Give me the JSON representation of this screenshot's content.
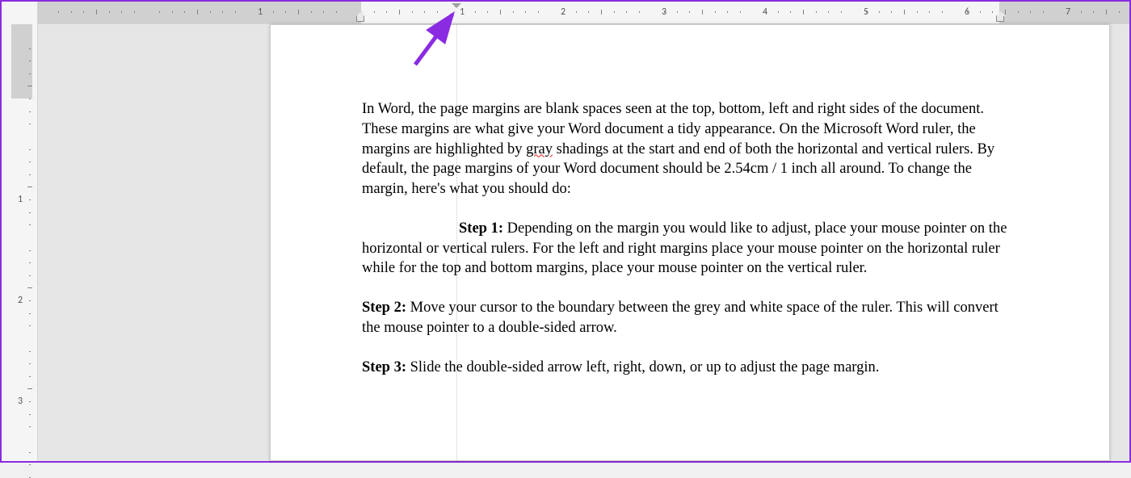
{
  "ruler": {
    "h_numbers": [
      1,
      1,
      2,
      3,
      4,
      5,
      6,
      7
    ],
    "v_numbers": [
      1,
      2,
      3
    ]
  },
  "document": {
    "intro": "In Word, the page margins are blank spaces seen at the top, bottom, left and right sides of the document. These margins are what give your Word document a tidy appearance. On the Microsoft Word ruler, the margins are highlighted by ",
    "spellerr": "gray",
    "intro2": " shadings at the start and end of both the horizontal and vertical rulers. By default, the page margins of your Word document should be 2.54cm / 1 inch all around. To change the margin, here's what you should do:",
    "step1_label": "Step 1:",
    "step1_body": " Depending on the margin you would like to adjust, place your mouse pointer on the horizontal or vertical rulers. For the left and right margins place your mouse pointer on the horizontal ruler while for the top and bottom margins, place your mouse pointer on the vertical ruler.",
    "step2_label": "Step 2:",
    "step2_body": " Move your cursor to the boundary between the grey and white space of the ruler. This will convert the mouse pointer to a double-sided arrow.",
    "step3_label": "Step 3:",
    "step3_body": " Slide the double-sided arrow left, right, down, or up to adjust the page margin."
  }
}
